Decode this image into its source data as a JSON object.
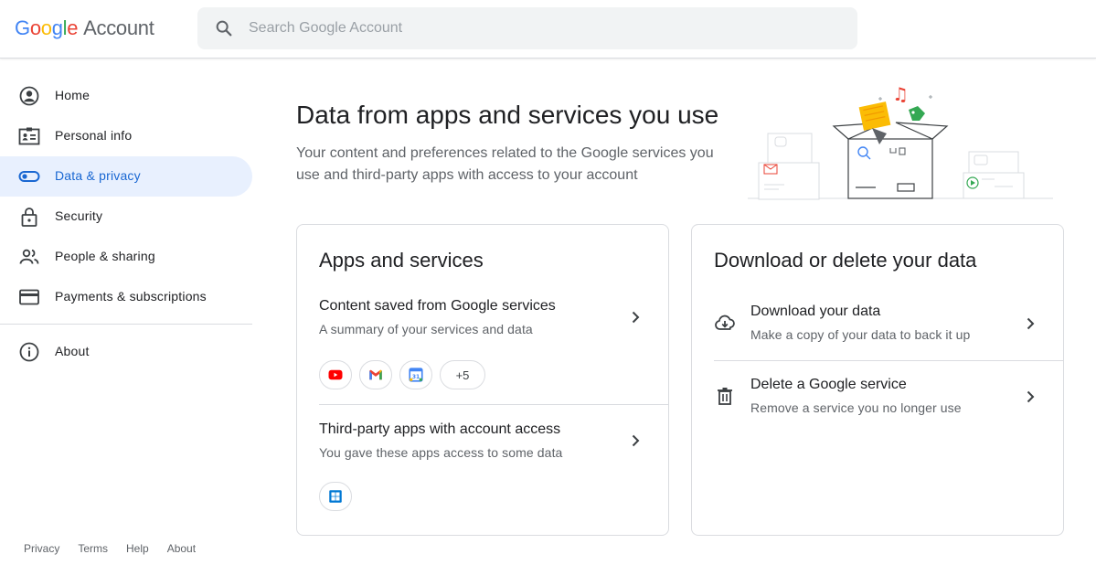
{
  "header": {
    "logo_letters": [
      "G",
      "o",
      "o",
      "g",
      "l",
      "e"
    ],
    "product": "Account",
    "search_placeholder": "Search Google Account"
  },
  "sidebar": {
    "items": [
      {
        "label": "Home",
        "icon": "account-circle-icon"
      },
      {
        "label": "Personal info",
        "icon": "id-card-icon"
      },
      {
        "label": "Data & privacy",
        "icon": "toggle-icon",
        "active": true
      },
      {
        "label": "Security",
        "icon": "lock-icon"
      },
      {
        "label": "People & sharing",
        "icon": "people-icon"
      },
      {
        "label": "Payments & subscriptions",
        "icon": "credit-card-icon"
      },
      {
        "label": "About",
        "icon": "info-icon"
      }
    ],
    "footer": [
      "Privacy",
      "Terms",
      "Help",
      "About"
    ]
  },
  "main": {
    "title": "Data from apps and services you use",
    "description": "Your content and preferences related to the Google services you use and third-party apps with access to your account"
  },
  "apps_card": {
    "title": "Apps and services",
    "rows": [
      {
        "title": "Content saved from Google services",
        "subtitle": "A summary of your services and data",
        "chips": [
          "youtube-icon",
          "gmail-icon",
          "calendar-icon"
        ],
        "more": "+5",
        "calendar_day": "31"
      },
      {
        "title": "Third-party apps with account access",
        "subtitle": "You gave these apps access to some data",
        "chips": [
          "windows-icon"
        ]
      }
    ]
  },
  "download_card": {
    "title": "Download or delete your data",
    "rows": [
      {
        "title": "Download your data",
        "subtitle": "Make a copy of your data to back it up",
        "icon": "cloud-download-icon"
      },
      {
        "title": "Delete a Google service",
        "subtitle": "Remove a service you no longer use",
        "icon": "trash-icon"
      }
    ]
  },
  "colors": {
    "accent": "#1967d2",
    "active_bg": "#e8f0fe",
    "google_blue": "#4285f4",
    "google_red": "#ea4335",
    "google_yellow": "#fbbc05",
    "google_green": "#34a853"
  }
}
